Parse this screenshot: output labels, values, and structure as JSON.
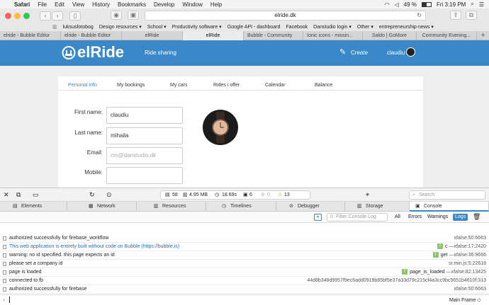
{
  "menubar": {
    "app": "Safari",
    "items": [
      "File",
      "Edit",
      "View",
      "History",
      "Bookmarks",
      "Develop",
      "Window",
      "Help"
    ],
    "battery": "49 %",
    "clock": "Fri 3:19 PM"
  },
  "browser": {
    "url": "elride.dk",
    "favorites": [
      "luksusfotobog",
      "Design resources ▾",
      "School ▾",
      "Productivity software ▾",
      "Google API - dashboard",
      "Facebook",
      "Danstudio login ▾",
      "Other ▾",
      "entrepreneurship-news ▾"
    ],
    "tabs": [
      "elride - Bubble Editor",
      "elride - Bubble Editor",
      "elRide",
      "elRide",
      "Bubble - Community",
      "Ionic icons - missin...",
      "Saldo | GoMore",
      "Community Evening..."
    ],
    "active_tab_index": 3
  },
  "site": {
    "logo": "elRide",
    "nav_link": "Ride sharing",
    "create_label": "Create",
    "username": "claudiu",
    "header_color": "#3a88c7"
  },
  "profile": {
    "tabs": [
      "Personal info",
      "My bookings",
      "My cars",
      "Rides i offer",
      "Calendar",
      "Balance"
    ],
    "active_tab": "Personal info",
    "first_name_label": "First name:",
    "first_name_value": "claudiu",
    "last_name_label": "Last name:",
    "last_name_value": "mihaila",
    "email_label": "Email:",
    "email_placeholder": "cm@danstudio.dk",
    "mobile_label": "Mobile:"
  },
  "devtools": {
    "stats": {
      "resources": "58",
      "size": "4.95 MB",
      "time": "18.69s",
      "logs": "6",
      "errors": "0",
      "warnings": "13"
    },
    "search_placeholder": "Search",
    "tabs": [
      "Elements",
      "Network",
      "Resources",
      "Timelines",
      "Debugger",
      "Storage",
      "Console"
    ],
    "active_tab": "Console",
    "filter_placeholder": "Filter Console Log",
    "filters": [
      "All",
      "Errors",
      "Warnings",
      "Logs"
    ],
    "console_rows": [
      {
        "msg": "authorized successfully for firebase_workflow",
        "src": "xfalse:50:6663",
        "badge": ""
      },
      {
        "msg": "This web application is entirely built without code on Bubble (https://bubble.is)",
        "src": "—xfalse:17:2420",
        "badge": "c",
        "blue": true
      },
      {
        "msg": "warning: no id specified.  this page expects an id",
        "src": "—xfalse:36:9666",
        "badge": "get"
      },
      {
        "msg": "please set a company id",
        "src": "sr.min.js:5:22618",
        "badge": ""
      },
      {
        "msg": "page is loaded",
        "src": "—xfalse:82:13425",
        "badge": "page_is_loaded"
      },
      {
        "msg": "connected to fb",
        "src": "44d8b348d9957f9ec6add0919b85bf5e37a33d79c215cf4a3cc9bc5651b4610f:313",
        "badge": ""
      },
      {
        "msg": "authorized successfully for firebase",
        "src": "xfalse:50:6663",
        "badge": ""
      }
    ],
    "frame_selector": "Main Frame"
  }
}
